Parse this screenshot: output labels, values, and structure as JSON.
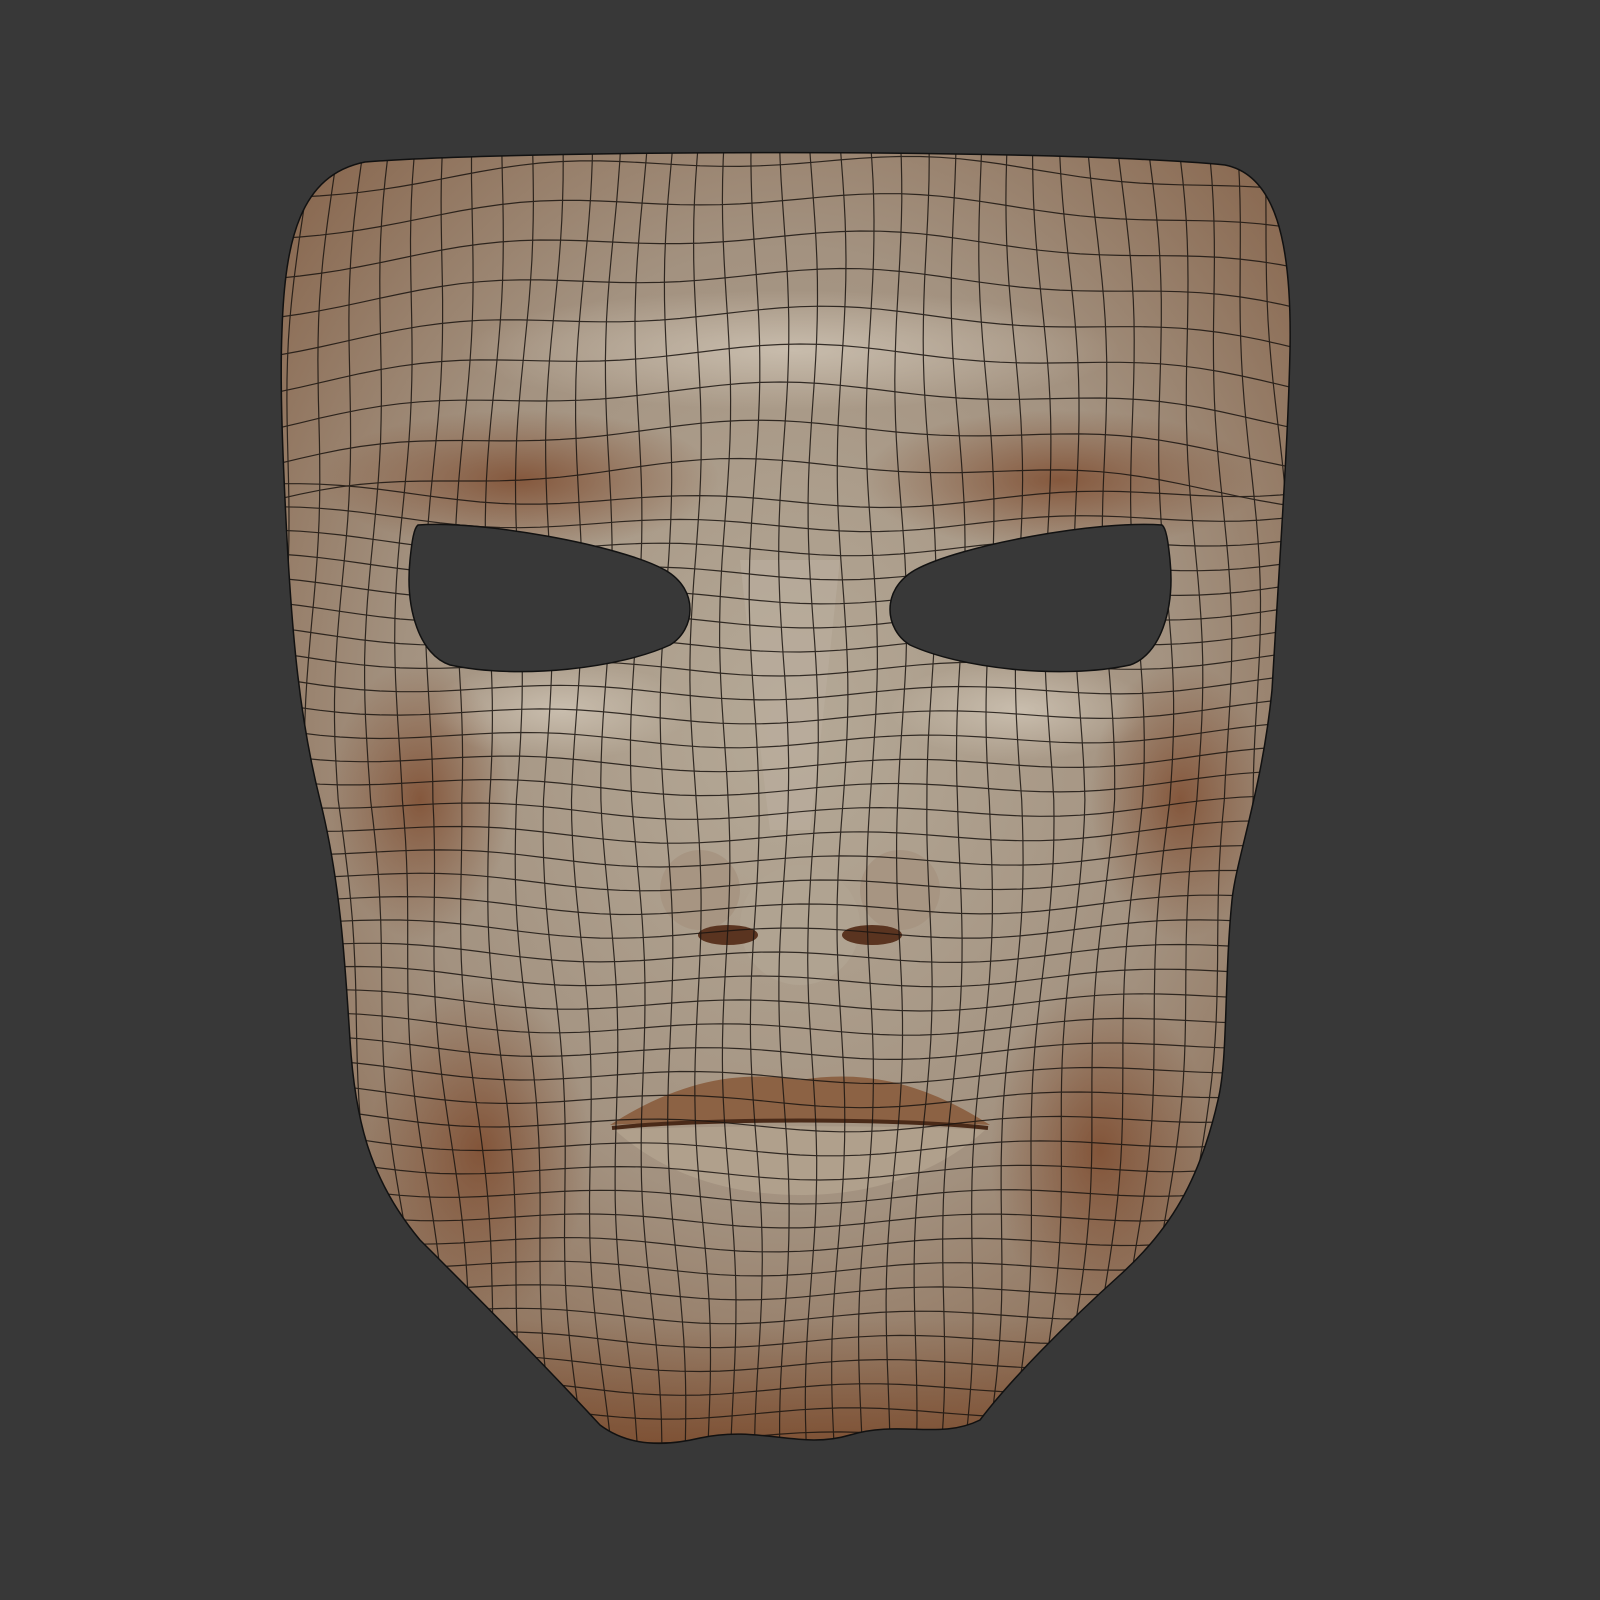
{
  "scene": {
    "subject": "wireframe-face-mask",
    "colors": {
      "background": "#383838",
      "skin_light": "#b3a796",
      "skin_mid": "#9a8470",
      "skin_shadow": "#7a4a2c",
      "wire": "#1a1410"
    }
  }
}
